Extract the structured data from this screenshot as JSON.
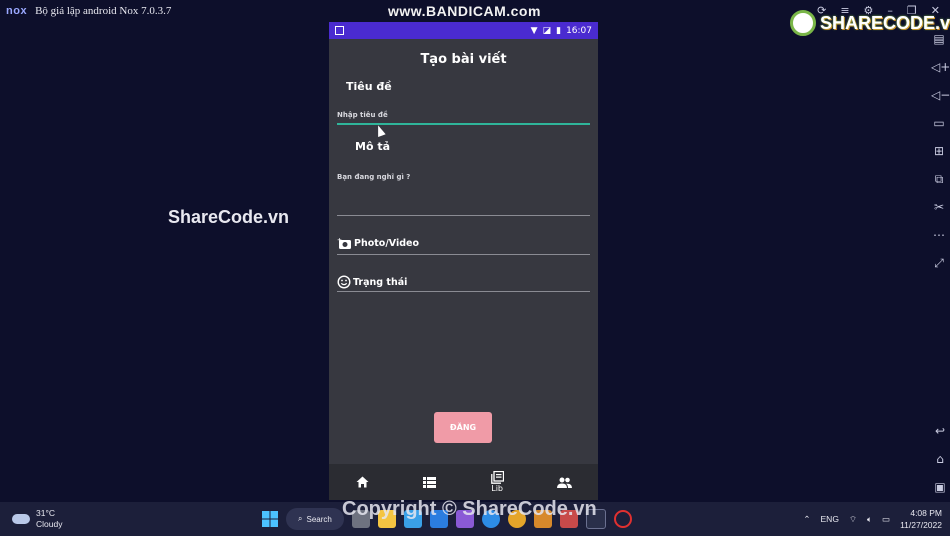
{
  "emulator": {
    "logo": "nox",
    "title": "Bộ giả lập android Nox 7.0.3.7",
    "recorder_watermark": "www.BANDICAM.com",
    "window_controls": [
      "⟳",
      "≡",
      "⚙",
      "–",
      "❐",
      "✕"
    ],
    "toolbar_tools": [
      "screen-icon",
      "volume-up-icon",
      "volume-down-icon",
      "display-icon",
      "add-apk-icon",
      "multi-instance-icon",
      "scissors-icon",
      "more-icon",
      "expand-icon"
    ],
    "toolbar_glyphs": [
      "▤",
      "◁+",
      "◁−",
      "▭",
      "⊞",
      "⧉",
      "✂",
      "⋯",
      "⤢"
    ],
    "nav_glyphs": [
      "↩",
      "⌂",
      "▣"
    ]
  },
  "watermarks": {
    "sharecode_logo": "SHARECODE.vn",
    "left": "ShareCode.vn",
    "bottom": "Copyright © ShareCode.vn"
  },
  "phone": {
    "status_bar": {
      "time": "16:07",
      "color": "#4a2bd0"
    },
    "app_title": "Tạo bài viết",
    "title_section": {
      "label": "Tiêu đề",
      "placeholder": "Nhập tiêu đề"
    },
    "description_section": {
      "label": "Mô tả",
      "placeholder": "Bạn đang nghĩ gì ?"
    },
    "options": [
      {
        "icon": "camera-plus-icon",
        "label": "Photo/Video"
      },
      {
        "icon": "smile-icon",
        "label": "Trạng thái"
      }
    ],
    "post_button": {
      "label": "ĐĂNG",
      "color": "#f09ba7"
    },
    "bottom_nav": [
      {
        "icon": "home-icon",
        "label": ""
      },
      {
        "icon": "list-icon",
        "label": ""
      },
      {
        "icon": "library-icon",
        "label": "Lib"
      },
      {
        "icon": "people-icon",
        "label": ""
      }
    ]
  },
  "taskbar": {
    "weather_temp": "31°C",
    "weather_desc": "Cloudy",
    "search_label": "Search",
    "language": "ENG",
    "time": "4:08 PM",
    "date": "11/27/2022"
  }
}
